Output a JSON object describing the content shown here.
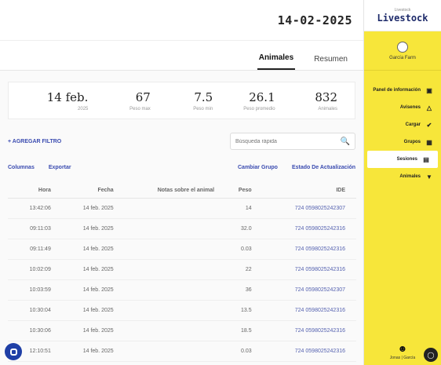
{
  "header": {
    "date": "14-02-2025"
  },
  "tabs": [
    {
      "label": "Resumen",
      "active": false
    },
    {
      "label": "Animales",
      "active": true
    }
  ],
  "stats": [
    {
      "value": "832",
      "label": "Animales"
    },
    {
      "value": "26.1",
      "label": "Peso promedio"
    },
    {
      "value": "7.5",
      "label": "Peso min"
    },
    {
      "value": "67",
      "label": "Peso max"
    },
    {
      "value": "14 feb.",
      "label": "2025"
    }
  ],
  "search": {
    "placeholder": "Búsqueda rápida"
  },
  "filter": {
    "add_label": "+ AGREGAR FILTRO"
  },
  "toolbar": {
    "status_label": "Estado De Actualización",
    "group_label": "Cambiar Grupo",
    "export_label": "Exportar",
    "columns_label": "Columnas"
  },
  "table": {
    "headers": [
      "IDE",
      "Peso",
      "Notas sobre el animal",
      "Fecha",
      "Hora"
    ],
    "rows": [
      [
        "724 0598025242307",
        "14",
        "",
        "14 feb. 2025",
        "13:42:06"
      ],
      [
        "724 0598025242316",
        "32.0",
        "",
        "14 feb. 2025",
        "09:11:03"
      ],
      [
        "724 0598025242316",
        "0.03",
        "",
        "14 feb. 2025",
        "09:11:49"
      ],
      [
        "724 0598025242316",
        "22",
        "",
        "14 feb. 2025",
        "10:02:09"
      ],
      [
        "724 0598025242307",
        "36",
        "",
        "14 feb. 2025",
        "10:03:59"
      ],
      [
        "724 0598025242316",
        "13.5",
        "",
        "14 feb. 2025",
        "10:30:04"
      ],
      [
        "724 0598025242316",
        "18.5",
        "",
        "14 feb. 2025",
        "10:30:06"
      ],
      [
        "724 0598025242316",
        "0.03",
        "",
        "14 feb. 2025",
        "12:10:51"
      ]
    ]
  },
  "sidebar": {
    "logo_small": "Livestock",
    "logo": "Livestock",
    "farm_name": "García Farm",
    "items": [
      {
        "label": "Panel de información",
        "icon": "dashboard-icon"
      },
      {
        "label": "Avisenes",
        "icon": "bell-icon"
      },
      {
        "label": "Cargar",
        "icon": "upload-icon"
      },
      {
        "label": "Grupos",
        "icon": "grid-icon"
      },
      {
        "label": "Sesiones",
        "icon": "session-icon",
        "active": true
      },
      {
        "label": "Animales",
        "icon": "cow-icon"
      }
    ],
    "user": "Jonas | García"
  },
  "colors": {
    "sidebar": "#f7e63a",
    "accent": "#3a4bb0",
    "chat": "#1f3fa6"
  }
}
